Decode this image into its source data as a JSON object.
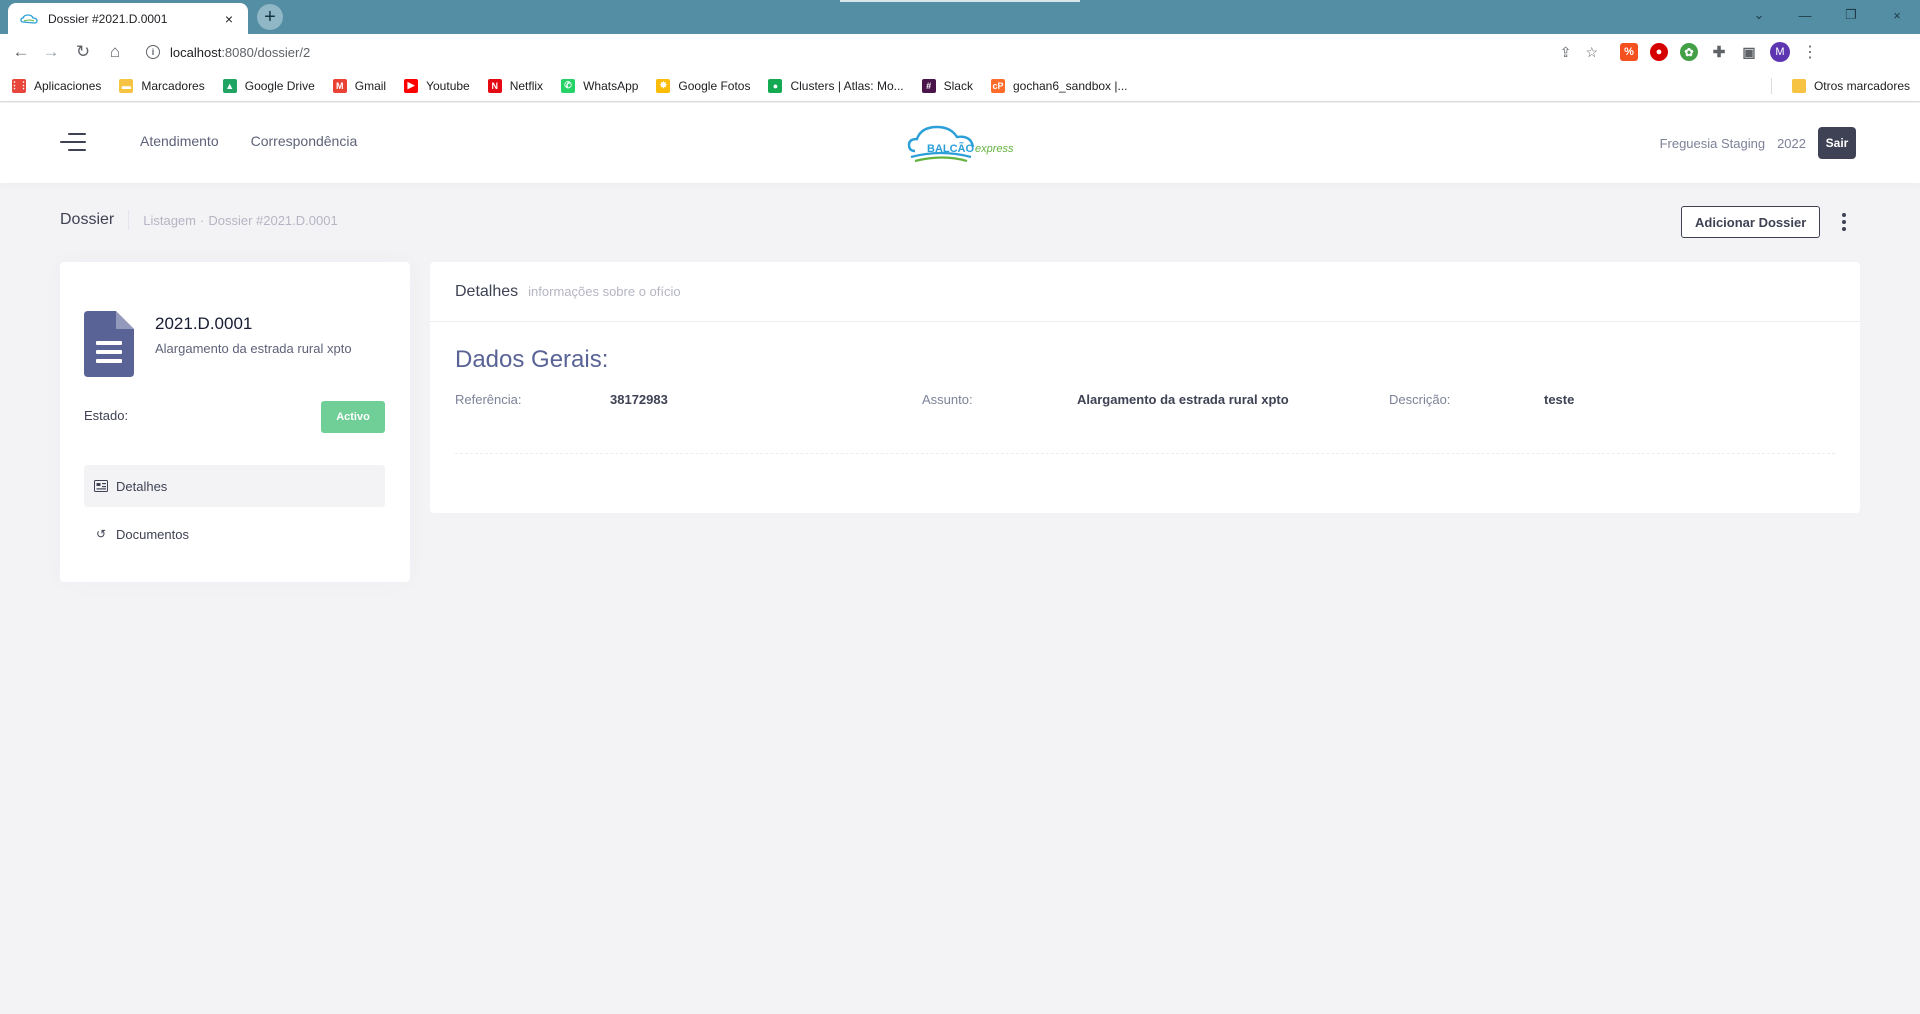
{
  "browser": {
    "tab_title": "Dossier #2021.D.0001",
    "tab_close": "×",
    "new_tab": "+",
    "url_host": "localhost",
    "url_path": ":8080/dossier/2",
    "win_min": "—",
    "win_restore": "❐",
    "win_dropdown": "⌄",
    "profile_initial": "M",
    "bookmarks": [
      {
        "label": "Aplicaciones",
        "icon": "apps-grid-icon",
        "color": "#e8453c"
      },
      {
        "label": "Marcadores",
        "icon": "folder-icon",
        "color": "#f6c343"
      },
      {
        "label": "Google Drive",
        "icon": "google-drive-icon",
        "color": "#1fa463"
      },
      {
        "label": "Gmail",
        "icon": "gmail-icon",
        "color": "#ea4335"
      },
      {
        "label": "Youtube",
        "icon": "youtube-icon",
        "color": "#ff0000"
      },
      {
        "label": "Netflix",
        "icon": "netflix-icon",
        "color": "#e50914"
      },
      {
        "label": "WhatsApp",
        "icon": "whatsapp-icon",
        "color": "#25d366"
      },
      {
        "label": "Google Fotos",
        "icon": "google-photos-icon",
        "color": "#fbbc05"
      },
      {
        "label": "Clusters | Atlas: Mo...",
        "icon": "mongodb-icon",
        "color": "#13aa52"
      },
      {
        "label": "Slack",
        "icon": "slack-icon",
        "color": "#4a154b"
      },
      {
        "label": "gochan6_sandbox |...",
        "icon": "cpanel-icon",
        "color": "#ff6c2c"
      }
    ],
    "other_bookmarks": "Otros marcadores"
  },
  "header": {
    "nav": [
      "Atendimento",
      "Correspondência"
    ],
    "logo_text_main": "BALCÃO",
    "logo_text_sub": "express",
    "org": "Freguesia Staging",
    "year": "2022",
    "logout": "Sair"
  },
  "subheader": {
    "title": "Dossier",
    "breadcrumb": [
      "Listagem",
      "·",
      "Dossier #2021.D.0001"
    ],
    "add_button": "Adicionar Dossier"
  },
  "left_card": {
    "number": "2021.D.0001",
    "description": "Alargamento da estrada rural xpto",
    "estado_label": "Estado:",
    "estado_value": "Activo",
    "menu": [
      {
        "label": "Detalhes",
        "icon": "details-card-icon",
        "active": true
      },
      {
        "label": "Documentos",
        "icon": "history-icon",
        "active": false
      }
    ]
  },
  "details": {
    "title": "Detalhes",
    "subtitle": "informações sobre o ofício",
    "section": "Dados Gerais:",
    "fields": [
      {
        "label": "Referência:",
        "value": "38172983"
      },
      {
        "label": "Assunto:",
        "value": "Alargamento da estrada rural xpto"
      },
      {
        "label": "Descrição:",
        "value": "teste"
      }
    ]
  },
  "colors": {
    "tabstrip": "#538ea4",
    "accent_title": "#5a6396",
    "badge_active": "#6fcf97",
    "dark_button": "#3f4254",
    "page_bg": "#f3f3f6"
  }
}
